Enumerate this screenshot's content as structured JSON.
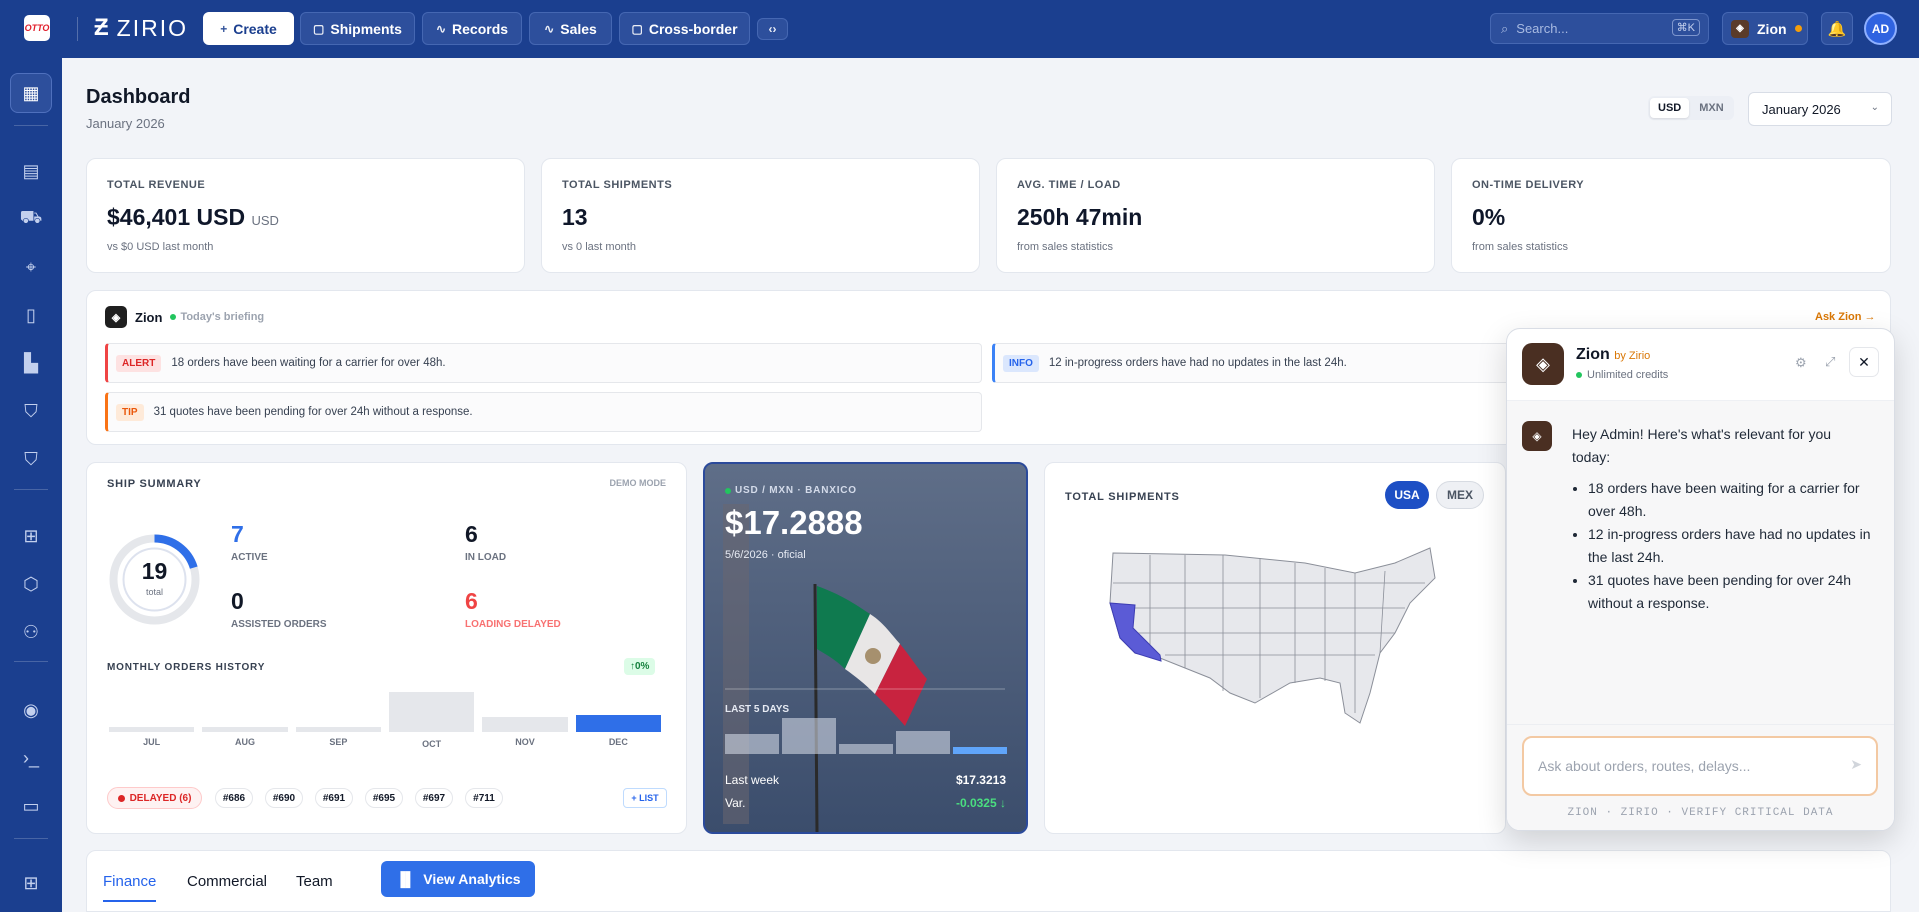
{
  "topbar": {
    "logo_text": "OTTO",
    "brand": "ZIRIO",
    "nav": [
      {
        "label": "Create",
        "icon": "plus-icon"
      },
      {
        "label": "Shipments",
        "icon": "box-icon"
      },
      {
        "label": "Records",
        "icon": "activity-icon"
      },
      {
        "label": "Sales",
        "icon": "activity-icon"
      },
      {
        "label": "Cross-border",
        "icon": "briefcase-icon"
      }
    ],
    "search_placeholder": "Search...",
    "search_shortcut": "⌘K",
    "zion_label": "Zion",
    "avatar_initials": "AD"
  },
  "page": {
    "title": "Dashboard",
    "subtitle": "January 2026",
    "currencies": [
      "USD",
      "MXN"
    ],
    "selected_currency": "USD",
    "month_select": "January 2026"
  },
  "kpis": [
    {
      "label": "TOTAL REVENUE",
      "value": "$46,401 USD",
      "unit": "USD",
      "sub": "vs $0 USD last month"
    },
    {
      "label": "TOTAL SHIPMENTS",
      "value": "13",
      "unit": "",
      "sub": "vs 0 last month"
    },
    {
      "label": "AVG. TIME / LOAD",
      "value": "250h 47min",
      "unit": "",
      "sub": "from sales statistics"
    },
    {
      "label": "ON-TIME DELIVERY",
      "value": "0%",
      "unit": "",
      "sub": "from sales statistics"
    }
  ],
  "briefing": {
    "name": "Zion",
    "status": "Today's briefing",
    "ask_link": "Ask Zion →",
    "items": [
      {
        "tag": "ALERT",
        "text": "18 orders have been waiting for a carrier for over 48h.",
        "color": "#ef4444"
      },
      {
        "tag": "INFO",
        "text": "12 in-progress orders have had no updates in the last 24h.",
        "color": "#3b82f6"
      },
      {
        "tag": "TIP",
        "text": "31 quotes have been pending for over 24h without a response.",
        "color": "#f97316"
      }
    ]
  },
  "ship_summary": {
    "title": "SHIP SUMMARY",
    "mode": "DEMO MODE",
    "total": "19",
    "total_label": "total",
    "total_value": 19,
    "active_value": 7,
    "stats": [
      {
        "value": "7",
        "label": "ACTIVE",
        "color": "#2f6fe8"
      },
      {
        "value": "6",
        "label": "IN LOAD",
        "color": "#111827"
      },
      {
        "value": "0",
        "label": "ASSISTED ORDERS",
        "color": "#111827"
      },
      {
        "value": "6",
        "label": "LOADING DELAYED",
        "color": "#ef4444"
      }
    ],
    "history_title": "MONTHLY ORDERS HISTORY",
    "history_change": "↑0%",
    "delayed_label": "DELAYED (6)",
    "delayed_ids": [
      "#686",
      "#690",
      "#691",
      "#695",
      "#697",
      "#711"
    ],
    "list_button": "+ LIST"
  },
  "chart_data": {
    "type": "bar",
    "categories": [
      "JUL",
      "AUG",
      "SEP",
      "OCT",
      "NOV",
      "DEC"
    ],
    "values": [
      1,
      1,
      1,
      8,
      3,
      3.5
    ],
    "title": "MONTHLY ORDERS HISTORY",
    "highlight": "DEC"
  },
  "fx": {
    "pair": "USD / MXN · BANXICO",
    "rate": "$17.2888",
    "date": "5/6/2026 · oficial",
    "last5_label": "LAST 5 DAYS",
    "last5_values": [
      17.25,
      17.3,
      17.22,
      17.26,
      17.21
    ],
    "last_week_label": "Last week",
    "last_week_value": "$17.3213",
    "var_label": "Var.",
    "var_value": "-0.0325 ↓"
  },
  "map_card": {
    "title": "TOTAL SHIPMENTS",
    "toggles": [
      "USA",
      "MEX"
    ],
    "selected": "USA",
    "highlight_state": "California",
    "highlight_color": "#5b5bd6"
  },
  "tabs": {
    "items": [
      "Finance",
      "Commercial",
      "Team"
    ],
    "active": "Finance",
    "analytics_button": "View Analytics"
  },
  "chat": {
    "name": "Zion",
    "by": "by Zirio",
    "credits": "Unlimited credits",
    "greeting": "Hey Admin! Here's what's relevant for you today:",
    "bullets": [
      "18 orders have been waiting for a carrier for over 48h.",
      "12 in-progress orders have had no updates in the last 24h.",
      "31 quotes have been pending for over 24h without a response."
    ],
    "input_placeholder": "Ask about orders, routes, delays...",
    "footer_note": "ZION · ZIRIO · VERIFY CRITICAL DATA"
  },
  "colors": {
    "brand": "#1b3f8f",
    "accent": "#2f6fe8",
    "alert": "#ef4444",
    "warn": "#d97706"
  }
}
